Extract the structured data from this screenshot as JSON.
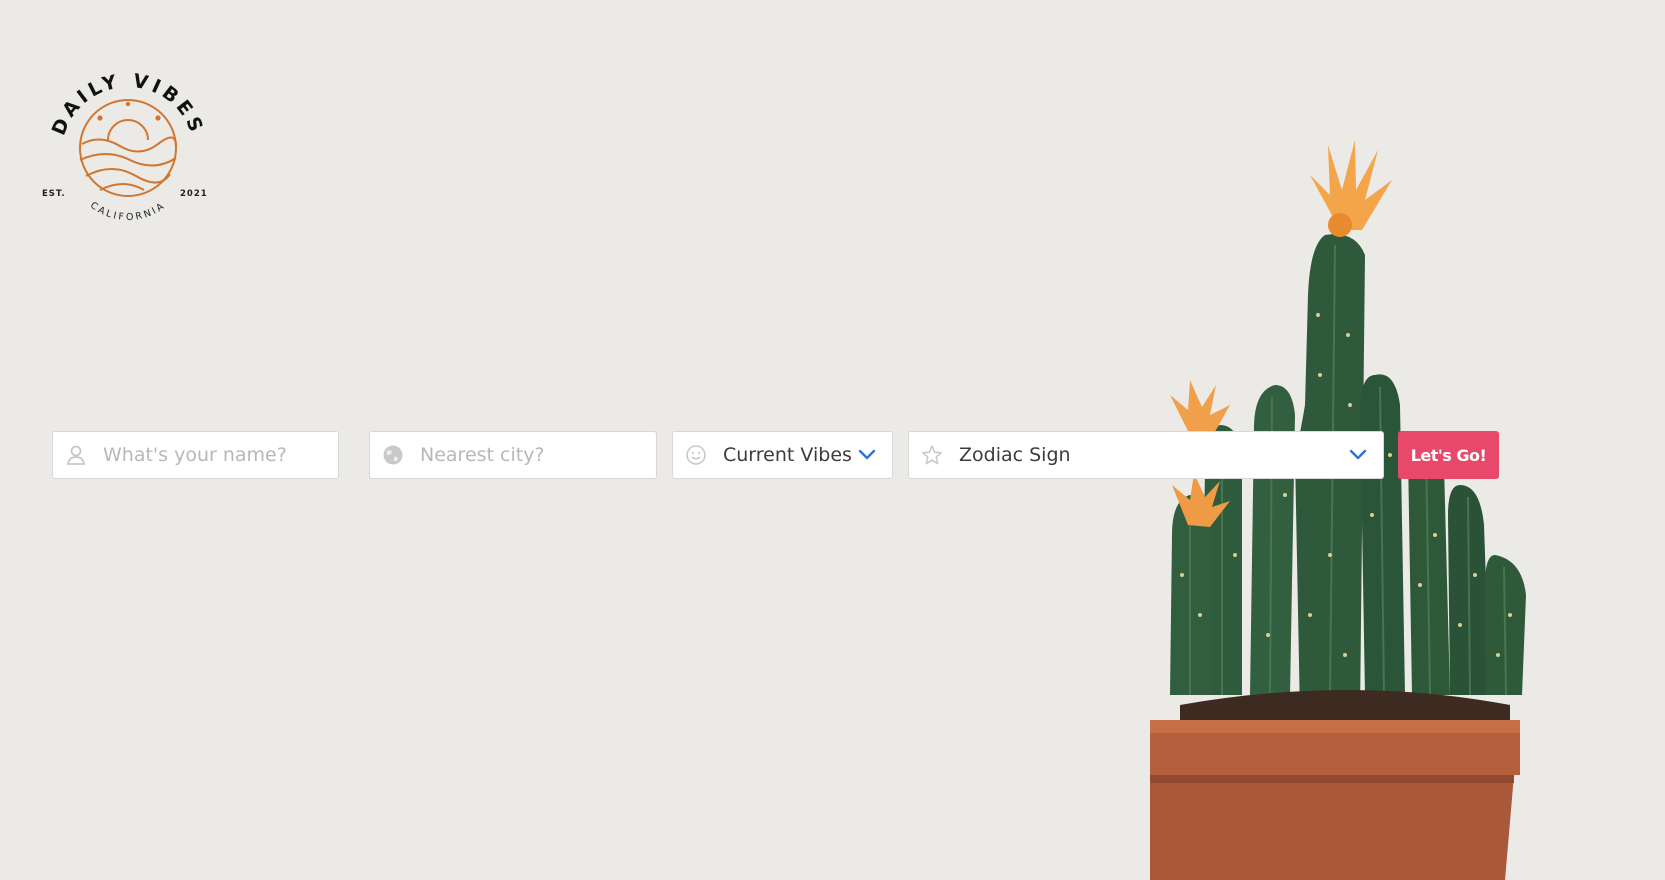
{
  "logo": {
    "brand": "DAILY VIBES",
    "est_label": "EST.",
    "year": "2021",
    "location": "CALIFORNIA",
    "accent_color": "#d1752f"
  },
  "form": {
    "name": {
      "placeholder": "What's your name?",
      "value": "",
      "icon": "user-icon"
    },
    "city": {
      "placeholder": "Nearest city?",
      "value": "",
      "icon": "globe-icon"
    },
    "vibes": {
      "selected": "Current Vibes",
      "icon": "smiley-icon"
    },
    "zodiac": {
      "selected": "Zodiac Sign",
      "icon": "star-icon"
    },
    "submit_label": "Let's Go!"
  },
  "colors": {
    "background": "#ebeae7",
    "button": "#e8496a",
    "chevron": "#2f73d9",
    "cactus_green": "#2f5a3a",
    "flower_orange": "#f4a449",
    "pot": "#b55f3c"
  }
}
